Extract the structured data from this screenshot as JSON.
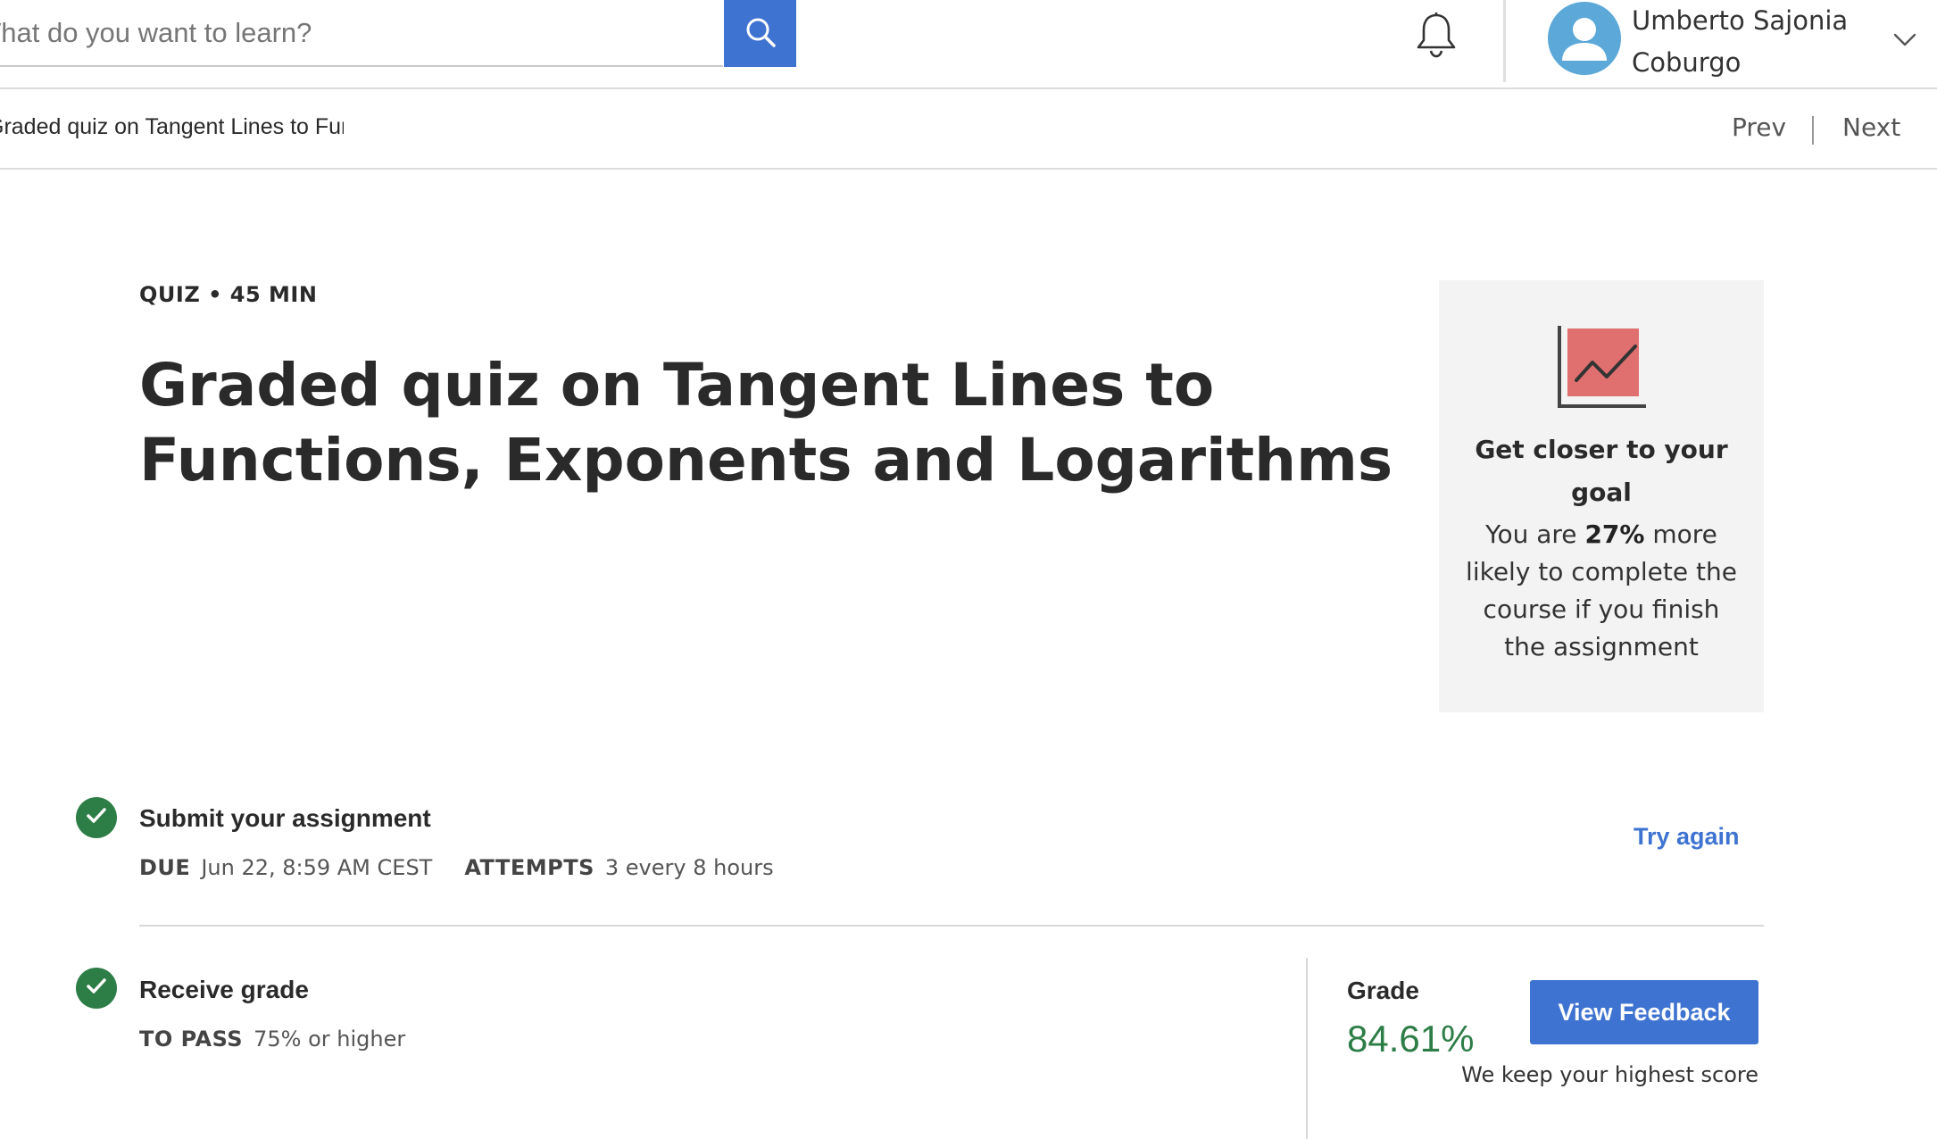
{
  "colors": {
    "accent": "#3f73d1",
    "success": "#2d7d46",
    "avatar": "#5ca8d8",
    "goal_chart": "#e07070"
  },
  "header": {
    "search": {
      "placeholder": "What do you want to learn?",
      "value": "",
      "button_icon": "search-icon"
    },
    "notifications_icon": "bell-icon",
    "user": {
      "name": "Umberto Sajonia Coburgo",
      "avatar_icon": "person-icon",
      "menu_icon": "chevron-down-icon"
    }
  },
  "breadcrumb": {
    "text": "Graded quiz on Tangent Lines to Functions, Exponents and Logarithms",
    "prev_label": "Prev",
    "next_label": "Next"
  },
  "quiz": {
    "meta": "QUIZ • 45 MIN",
    "title": "Graded quiz on Tangent Lines to Functions, Exponents and Logarithms"
  },
  "goal_card": {
    "icon": "chart-trend-icon",
    "heading": "Get closer to your goal",
    "text_before": "You are ",
    "highlight": "27%",
    "text_after": " more likely to complete the course if you finish the assignment"
  },
  "steps": {
    "submit": {
      "status_icon": "check-icon",
      "title": "Submit your assignment",
      "due_label": "DUE",
      "due_value": "Jun 22, 8:59 AM CEST",
      "attempts_label": "ATTEMPTS",
      "attempts_value": "3 every 8 hours",
      "action_label": "Try again"
    },
    "grade": {
      "status_icon": "check-icon",
      "title": "Receive grade",
      "pass_label": "TO PASS",
      "pass_value": "75% or higher",
      "grade_label": "Grade",
      "grade_value": "84.61%",
      "feedback_button": "View Feedback",
      "note": "We keep your highest score"
    }
  }
}
